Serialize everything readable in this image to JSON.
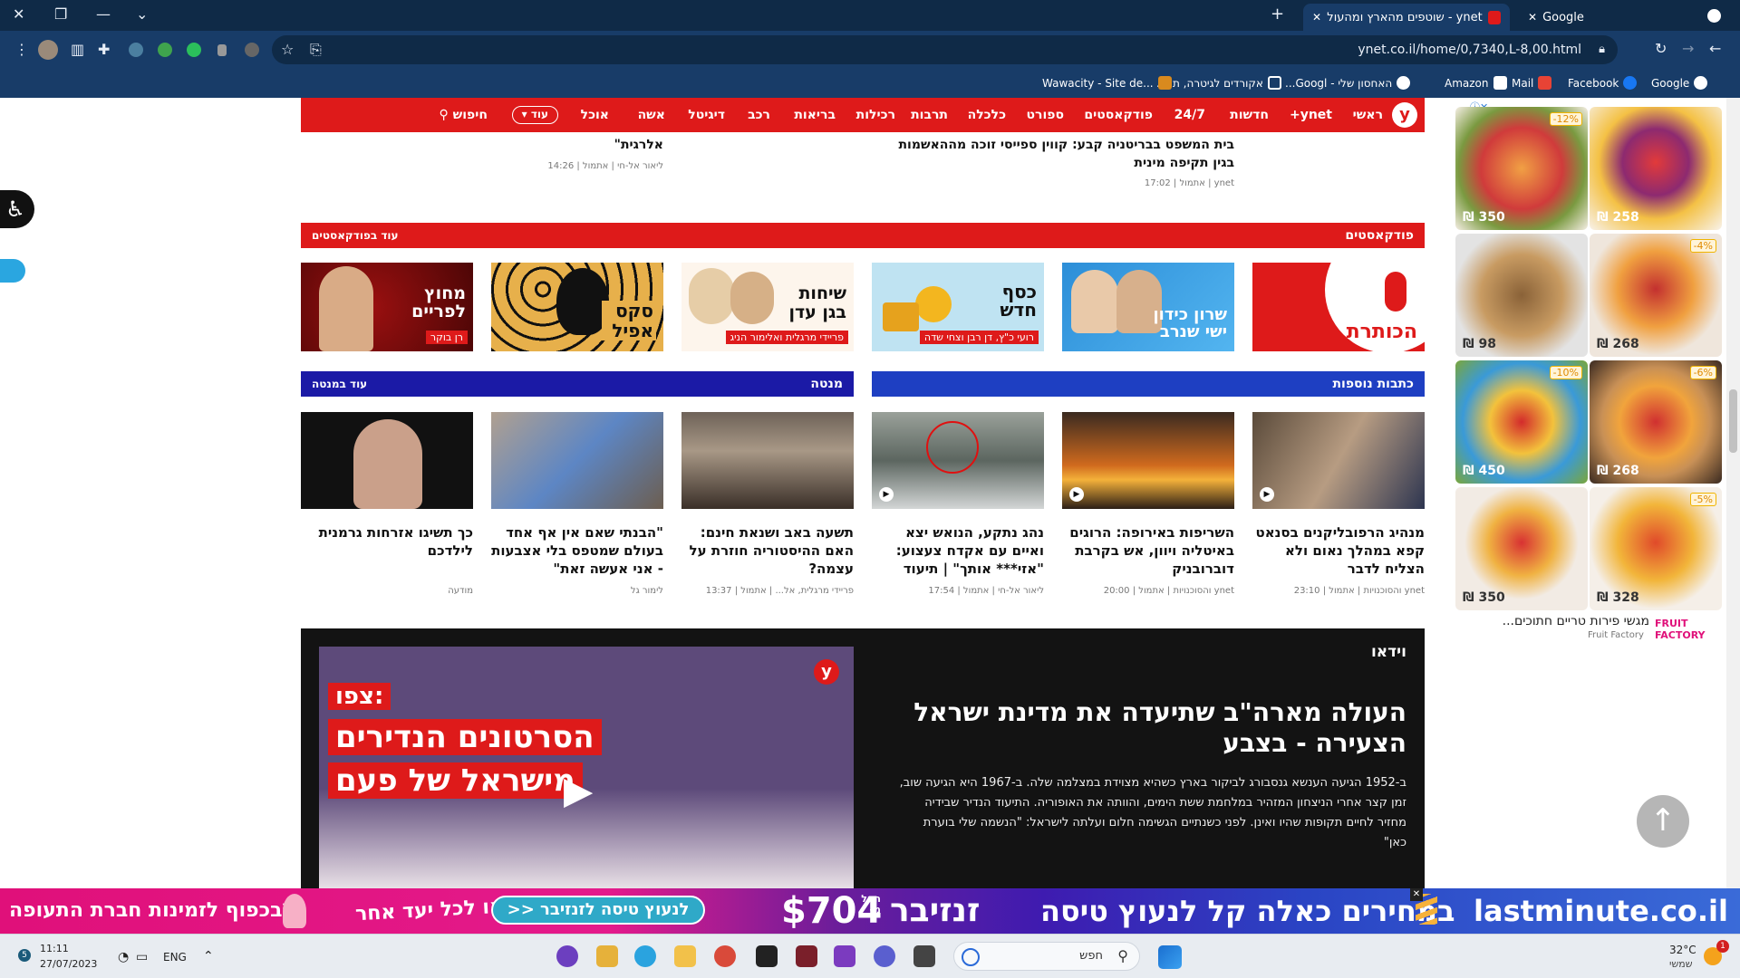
{
  "browser": {
    "tabs": [
      {
        "title": "ynet - שוטפים מהארץ ומהעולם ...",
        "active": true
      },
      {
        "title": "Google",
        "active": false
      }
    ],
    "url": "ynet.co.il/home/0,7340,L-8,00.html",
    "bookmarks": [
      "Google",
      "Facebook",
      "Mail",
      "Amazon",
      "האחסון שלי - Googl...",
      "אקורדים לגיטרה, תוו...",
      "Wawacity - Site de..."
    ]
  },
  "nav": {
    "logo": "y",
    "items": [
      "ראשי",
      "ynet+",
      "חדשות",
      "24/7",
      "פודקאסטים",
      "ספורט",
      "כלכלה",
      "תרבות",
      "רכילות",
      "בריאות",
      "רכב",
      "דיגיטל",
      "אשה",
      "אוכל"
    ],
    "more": "עוד",
    "search": "חיפוש"
  },
  "top_articles": [
    {
      "title": "בית המשפט בבריטניה קבע: קווין ספייסי זוכה מההאשמות בגין תקיפה מינית",
      "meta": "ynet | אתמול | 17:02"
    },
    {
      "title": "אלרגית\"",
      "meta": "ליאור אל-חי | אתמול | 14:26"
    }
  ],
  "podcasts": {
    "title": "פודקאסטים",
    "more": "עוד בפודקאסטים",
    "items": [
      {
        "name": "הכותרת",
        "sub": ""
      },
      {
        "name": "שרון כידון ישי שנרב",
        "sub": ""
      },
      {
        "name": "כסף חדש",
        "sub": "רועי כ\"ץ, דן רבן וצחי שדה"
      },
      {
        "name": "שיחות בגן עדן",
        "sub": "פריידי מרגלית ואלימור הניג"
      },
      {
        "name": "סקס אפיל",
        "sub": ""
      },
      {
        "name": "מחוץ לפריים",
        "sub": "רן בוקר"
      }
    ]
  },
  "more_articles": {
    "title": "כתבות נוספות",
    "items": [
      {
        "title": "מנהיג הרפובליקנים בסנאט קפא במהלך נאום ולא הצליח לדבר",
        "meta": "ynet והסוכנויות | אתמול | 23:10",
        "video": true
      },
      {
        "title": "השריפות באירופה: הרוגים באיטליה ויוון, אש בקרבת דוברובניק",
        "meta": "ynet והסוכנויות | אתמול | 20:00",
        "video": true
      },
      {
        "title": "נהג נתקע, הנואש יצא ואיים עם אקדח צעצוע: \"אזי*** אותך\" | תיעוד",
        "meta": "ליאור אל-חי | אתמול | 17:54",
        "video": true
      }
    ]
  },
  "menta": {
    "title": "מנטה",
    "more": "עוד במנטה",
    "items": [
      {
        "title": "תשעה באב ושנאת חינם: האם ההיסטוריה חוזרת על עצמה?",
        "meta": "פריידי מרגלית, אל... | אתמול | 13:37"
      },
      {
        "title": "\"הבנתי שאם אין אף אחד בעולם שמטפס בלי אצבעות - אני אעשה זאת\"",
        "meta": "לימור גל"
      },
      {
        "title": "כך תשיגו אזרחות גרמנית לילדכם",
        "meta": "מודעה"
      }
    ]
  },
  "video": {
    "section": "וידאו",
    "headline": "העולה מארה\"ב שתיעדה את מדינת ישראל הצעירה - בצבע",
    "body": "ב-1952 הגיעה הענשא גנסבורג לביקור בארץ כשהיא מצוידת במצלמה שלה. ב-1967 היא הגיעה שוב, זמן קצר אחרי הניצחון המזהיר במלחמת ששת הימים, והוותה את האופוריה. התיעוד הנדיר שבידיה מחזיר לחיים תקופות שהיו ואינן. לפני כשנתיים הגשימה חלום ועלתה לישראל: \"הנשמה שלי בוערת כאן\"",
    "overlay_small": "צפו:",
    "overlay_big1": "הסרטונים הנדירים",
    "overlay_big2": "מישראל של פעם",
    "logo": "y"
  },
  "side_ad": {
    "tiles": [
      {
        "price": "₪ 350",
        "discount": "-12%"
      },
      {
        "price": "₪ 258",
        "discount": ""
      },
      {
        "price": "₪ 98",
        "discount": ""
      },
      {
        "price": "₪ 268",
        "discount": "-4%"
      },
      {
        "price": "₪ 450",
        "discount": "-10%"
      },
      {
        "price": "₪ 268",
        "discount": "-6%"
      },
      {
        "price": "₪ 350",
        "discount": ""
      },
      {
        "price": "₪ 328",
        "discount": "-5%"
      }
    ],
    "caption": "מגשי פירות טריים חתוכים...",
    "brand": "FRUIT FACTORY",
    "brand_sub": "Fruit Factory"
  },
  "bottom_ad": {
    "brand": "lastminute.co.il",
    "tagline": "במחירים כאלה קל לנעוץ טיסה",
    "dest": "זנזיבר",
    "price": "$704",
    "price_prefix": "החל מ-",
    "cta": "לנעוץ טיסה לזנזיבר <<",
    "side": "או לכל יעד אחר",
    "note": "*בכפוף לזמינות חברת התעופה"
  },
  "taskbar": {
    "search": "חפש",
    "lang": "ENG",
    "time": "11:11",
    "date": "27/07/2023",
    "temp": "32°C",
    "weather": "שמשי",
    "badge": "1"
  },
  "colors": {
    "ynet_red": "#de1a1a",
    "menta_blue": "#1b1aa6",
    "more_blue": "#1e3fc2"
  }
}
